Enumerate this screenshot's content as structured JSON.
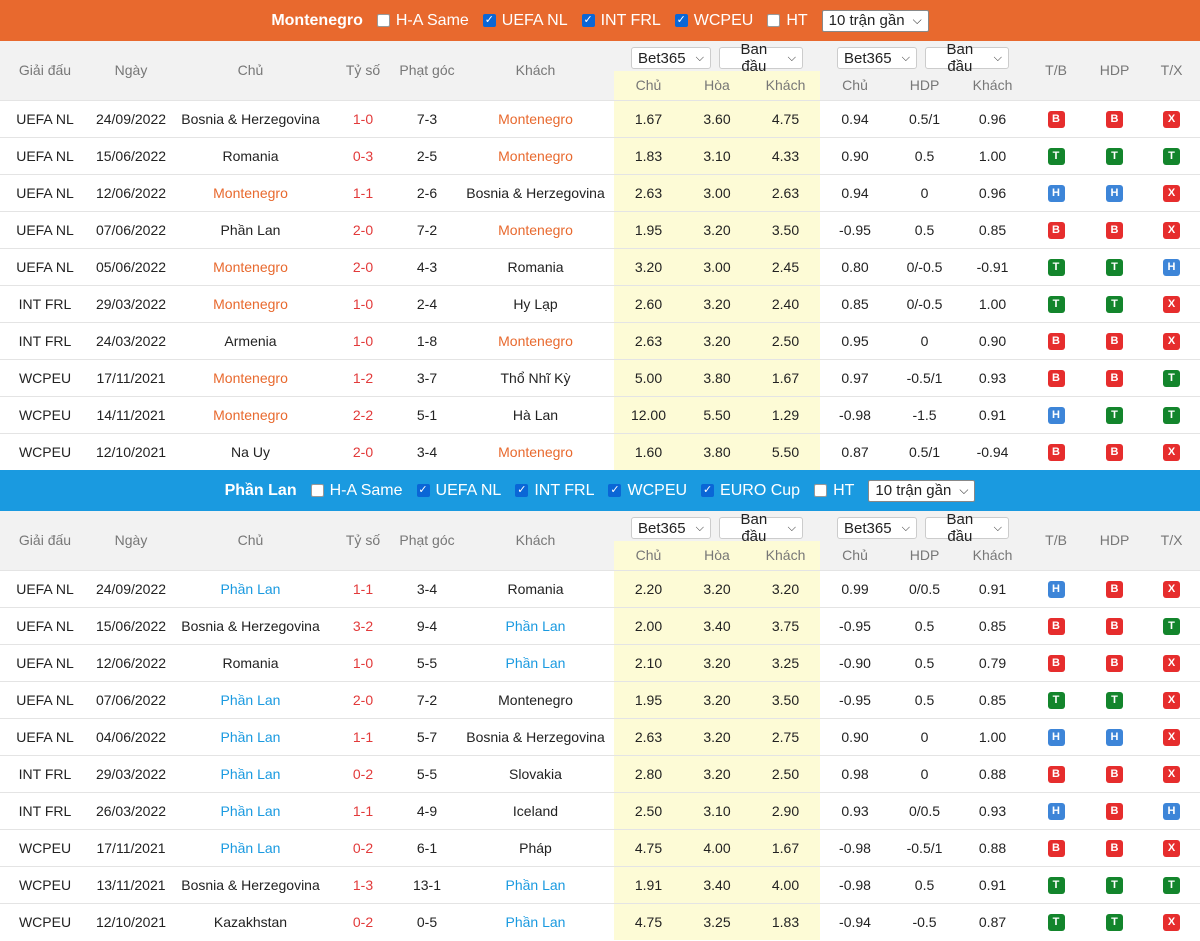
{
  "colors": {
    "orange": "#e8692e",
    "blue": "#1a9ae0",
    "red_badge": "#e62d2d",
    "green_badge": "#13852c",
    "blue_badge": "#3d85d8"
  },
  "columns": {
    "league": "Giải đấu",
    "date": "Ngày",
    "home": "Chủ",
    "score": "Tỷ số",
    "corners": "Phạt góc",
    "away": "Khách",
    "bookmaker": "Bet365",
    "odds_type": "Ban đầu",
    "o_home": "Chủ",
    "o_draw": "Hòa",
    "o_away": "Khách",
    "a_home": "Chủ",
    "a_hdp": "HDP",
    "a_away": "Khách",
    "tb": "T/B",
    "hdp": "HDP",
    "tx": "T/X"
  },
  "sections": [
    {
      "team": "Montenegro",
      "filters": [
        {
          "label": "H-A Same",
          "checked": false
        },
        {
          "label": "UEFA NL",
          "checked": true
        },
        {
          "label": "INT FRL",
          "checked": true
        },
        {
          "label": "WCPEU",
          "checked": true
        },
        {
          "label": "HT",
          "checked": false
        }
      ],
      "count_select": "10 trận gần",
      "rows": [
        {
          "league": "UEFA NL",
          "date": "24/09/2022",
          "home": "Bosnia & Herzegovina",
          "score": "1-0",
          "corners": "7-3",
          "away": "Montenegro",
          "hl": "away",
          "o1": "1.67",
          "ox": "3.60",
          "o2": "4.75",
          "a1": "0.94",
          "ah": "0.5/1",
          "a2": "0.96",
          "tb": "B",
          "hdp": "B",
          "tx": "X"
        },
        {
          "league": "UEFA NL",
          "date": "15/06/2022",
          "home": "Romania",
          "score": "0-3",
          "corners": "2-5",
          "away": "Montenegro",
          "hl": "away",
          "o1": "1.83",
          "ox": "3.10",
          "o2": "4.33",
          "a1": "0.90",
          "ah": "0.5",
          "a2": "1.00",
          "tb": "T",
          "hdp": "T",
          "tx": "T"
        },
        {
          "league": "UEFA NL",
          "date": "12/06/2022",
          "home": "Montenegro",
          "score": "1-1",
          "corners": "2-6",
          "away": "Bosnia & Herzegovina",
          "hl": "home",
          "o1": "2.63",
          "ox": "3.00",
          "o2": "2.63",
          "a1": "0.94",
          "ah": "0",
          "a2": "0.96",
          "tb": "H",
          "hdp": "H",
          "tx": "X"
        },
        {
          "league": "UEFA NL",
          "date": "07/06/2022",
          "home": "Phần Lan",
          "score": "2-0",
          "corners": "7-2",
          "away": "Montenegro",
          "hl": "away",
          "o1": "1.95",
          "ox": "3.20",
          "o2": "3.50",
          "a1": "-0.95",
          "ah": "0.5",
          "a2": "0.85",
          "tb": "B",
          "hdp": "B",
          "tx": "X"
        },
        {
          "league": "UEFA NL",
          "date": "05/06/2022",
          "home": "Montenegro",
          "score": "2-0",
          "corners": "4-3",
          "away": "Romania",
          "hl": "home",
          "o1": "3.20",
          "ox": "3.00",
          "o2": "2.45",
          "a1": "0.80",
          "ah": "0/-0.5",
          "a2": "-0.91",
          "tb": "T",
          "hdp": "T",
          "tx": "H"
        },
        {
          "league": "INT FRL",
          "date": "29/03/2022",
          "home": "Montenegro",
          "score": "1-0",
          "corners": "2-4",
          "away": "Hy Lạp",
          "hl": "home",
          "o1": "2.60",
          "ox": "3.20",
          "o2": "2.40",
          "a1": "0.85",
          "ah": "0/-0.5",
          "a2": "1.00",
          "tb": "T",
          "hdp": "T",
          "tx": "X"
        },
        {
          "league": "INT FRL",
          "date": "24/03/2022",
          "home": "Armenia",
          "score": "1-0",
          "corners": "1-8",
          "away": "Montenegro",
          "hl": "away",
          "o1": "2.63",
          "ox": "3.20",
          "o2": "2.50",
          "a1": "0.95",
          "ah": "0",
          "a2": "0.90",
          "tb": "B",
          "hdp": "B",
          "tx": "X"
        },
        {
          "league": "WCPEU",
          "date": "17/11/2021",
          "home": "Montenegro",
          "score": "1-2",
          "corners": "3-7",
          "away": "Thổ Nhĩ Kỳ",
          "hl": "home",
          "o1": "5.00",
          "ox": "3.80",
          "o2": "1.67",
          "a1": "0.97",
          "ah": "-0.5/1",
          "a2": "0.93",
          "tb": "B",
          "hdp": "B",
          "tx": "T"
        },
        {
          "league": "WCPEU",
          "date": "14/11/2021",
          "home": "Montenegro",
          "score": "2-2",
          "corners": "5-1",
          "away": "Hà Lan",
          "hl": "home",
          "o1": "12.00",
          "ox": "5.50",
          "o2": "1.29",
          "a1": "-0.98",
          "ah": "-1.5",
          "a2": "0.91",
          "tb": "H",
          "hdp": "T",
          "tx": "T"
        },
        {
          "league": "WCPEU",
          "date": "12/10/2021",
          "home": "Na Uy",
          "score": "2-0",
          "corners": "3-4",
          "away": "Montenegro",
          "hl": "away",
          "o1": "1.60",
          "ox": "3.80",
          "o2": "5.50",
          "a1": "0.87",
          "ah": "0.5/1",
          "a2": "-0.94",
          "tb": "B",
          "hdp": "B",
          "tx": "X"
        }
      ]
    },
    {
      "team": "Phần Lan",
      "filters": [
        {
          "label": "H-A Same",
          "checked": false
        },
        {
          "label": "UEFA NL",
          "checked": true
        },
        {
          "label": "INT FRL",
          "checked": true
        },
        {
          "label": "WCPEU",
          "checked": true
        },
        {
          "label": "EURO Cup",
          "checked": true
        },
        {
          "label": "HT",
          "checked": false
        }
      ],
      "count_select": "10 trận gần",
      "rows": [
        {
          "league": "UEFA NL",
          "date": "24/09/2022",
          "home": "Phần Lan",
          "score": "1-1",
          "corners": "3-4",
          "away": "Romania",
          "hl": "home",
          "o1": "2.20",
          "ox": "3.20",
          "o2": "3.20",
          "a1": "0.99",
          "ah": "0/0.5",
          "a2": "0.91",
          "tb": "H",
          "hdp": "B",
          "tx": "X"
        },
        {
          "league": "UEFA NL",
          "date": "15/06/2022",
          "home": "Bosnia & Herzegovina",
          "score": "3-2",
          "corners": "9-4",
          "away": "Phần Lan",
          "hl": "away",
          "o1": "2.00",
          "ox": "3.40",
          "o2": "3.75",
          "a1": "-0.95",
          "ah": "0.5",
          "a2": "0.85",
          "tb": "B",
          "hdp": "B",
          "tx": "T"
        },
        {
          "league": "UEFA NL",
          "date": "12/06/2022",
          "home": "Romania",
          "score": "1-0",
          "corners": "5-5",
          "away": "Phần Lan",
          "hl": "away",
          "o1": "2.10",
          "ox": "3.20",
          "o2": "3.25",
          "a1": "-0.90",
          "ah": "0.5",
          "a2": "0.79",
          "tb": "B",
          "hdp": "B",
          "tx": "X"
        },
        {
          "league": "UEFA NL",
          "date": "07/06/2022",
          "home": "Phần Lan",
          "score": "2-0",
          "corners": "7-2",
          "away": "Montenegro",
          "hl": "home",
          "o1": "1.95",
          "ox": "3.20",
          "o2": "3.50",
          "a1": "-0.95",
          "ah": "0.5",
          "a2": "0.85",
          "tb": "T",
          "hdp": "T",
          "tx": "X"
        },
        {
          "league": "UEFA NL",
          "date": "04/06/2022",
          "home": "Phần Lan",
          "score": "1-1",
          "corners": "5-7",
          "away": "Bosnia & Herzegovina",
          "hl": "home",
          "o1": "2.63",
          "ox": "3.20",
          "o2": "2.75",
          "a1": "0.90",
          "ah": "0",
          "a2": "1.00",
          "tb": "H",
          "hdp": "H",
          "tx": "X"
        },
        {
          "league": "INT FRL",
          "date": "29/03/2022",
          "home": "Phần Lan",
          "score": "0-2",
          "corners": "5-5",
          "away": "Slovakia",
          "hl": "home",
          "o1": "2.80",
          "ox": "3.20",
          "o2": "2.50",
          "a1": "0.98",
          "ah": "0",
          "a2": "0.88",
          "tb": "B",
          "hdp": "B",
          "tx": "X"
        },
        {
          "league": "INT FRL",
          "date": "26/03/2022",
          "home": "Phần Lan",
          "score": "1-1",
          "corners": "4-9",
          "away": "Iceland",
          "hl": "home",
          "o1": "2.50",
          "ox": "3.10",
          "o2": "2.90",
          "a1": "0.93",
          "ah": "0/0.5",
          "a2": "0.93",
          "tb": "H",
          "hdp": "B",
          "tx": "H"
        },
        {
          "league": "WCPEU",
          "date": "17/11/2021",
          "home": "Phần Lan",
          "score": "0-2",
          "corners": "6-1",
          "away": "Pháp",
          "hl": "home",
          "o1": "4.75",
          "ox": "4.00",
          "o2": "1.67",
          "a1": "-0.98",
          "ah": "-0.5/1",
          "a2": "0.88",
          "tb": "B",
          "hdp": "B",
          "tx": "X"
        },
        {
          "league": "WCPEU",
          "date": "13/11/2021",
          "home": "Bosnia & Herzegovina",
          "score": "1-3",
          "corners": "13-1",
          "away": "Phần Lan",
          "hl": "away",
          "o1": "1.91",
          "ox": "3.40",
          "o2": "4.00",
          "a1": "-0.98",
          "ah": "0.5",
          "a2": "0.91",
          "tb": "T",
          "hdp": "T",
          "tx": "T"
        },
        {
          "league": "WCPEU",
          "date": "12/10/2021",
          "home": "Kazakhstan",
          "score": "0-2",
          "corners": "0-5",
          "away": "Phần Lan",
          "hl": "away",
          "o1": "4.75",
          "ox": "3.25",
          "o2": "1.83",
          "a1": "-0.94",
          "ah": "-0.5",
          "a2": "0.87",
          "tb": "T",
          "hdp": "T",
          "tx": "X"
        }
      ]
    }
  ]
}
